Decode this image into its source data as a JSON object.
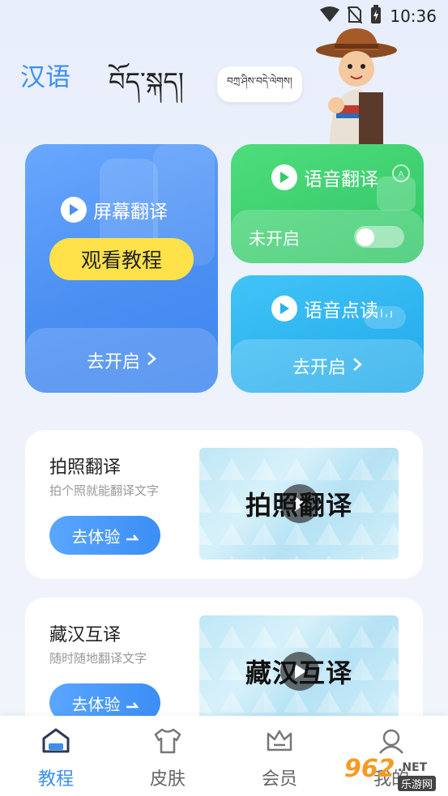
{
  "status_bar": {
    "time": "10:36",
    "icons": [
      "wifi-icon",
      "no-sim-icon",
      "battery-charging-icon"
    ]
  },
  "header": {
    "lang_chinese": "汉语",
    "lang_tibetan": "བོད་སྐད།",
    "bubble_text": "བཀྲ་ཤིས་བདེ་ལེགས།"
  },
  "features": {
    "screen_translate": {
      "title": "屏幕翻译",
      "tutorial_button": "观看教程",
      "enable_label": "去开启"
    },
    "voice_translate": {
      "title": "语音翻译",
      "status": "未开启"
    },
    "voice_read": {
      "title": "语音点读",
      "enable_label": "去开启"
    }
  },
  "list": [
    {
      "title": "拍照翻译",
      "subtitle": "拍个照就能翻译文字",
      "button": "去体验",
      "thumb_text": "拍照翻译"
    },
    {
      "title": "藏汉互译",
      "subtitle": "随时随地翻译文字",
      "button": "去体验",
      "thumb_text": "藏汉互译"
    }
  ],
  "nav": {
    "items": [
      {
        "label": "教程",
        "icon": "home-icon",
        "active": true
      },
      {
        "label": "皮肤",
        "icon": "shirt-icon",
        "active": false
      },
      {
        "label": "会员",
        "icon": "crown-icon",
        "active": false
      },
      {
        "label": "我的",
        "icon": "profile-icon",
        "active": false
      }
    ]
  },
  "watermark": {
    "number": "962",
    "suffix": ".NET",
    "site": "乐游网"
  },
  "colors": {
    "accent_blue": "#3a8ff0",
    "screen_card": "#4b8ff2",
    "voice_card": "#35cb6b",
    "read_card": "#2ab2ee",
    "tutorial_yellow": "#ffe24a"
  }
}
